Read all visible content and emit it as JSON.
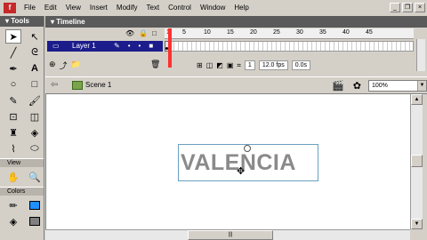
{
  "menubar": {
    "items": [
      "File",
      "Edit",
      "View",
      "Insert",
      "Modify",
      "Text",
      "Control",
      "Window",
      "Help"
    ]
  },
  "tools_panel": {
    "title": "Tools",
    "view_label": "View",
    "colors_label": "Colors",
    "fill_color": "#1e90ff"
  },
  "timeline": {
    "title": "Timeline",
    "ruler_numbers": [
      "1",
      "5",
      "10",
      "15",
      "20",
      "25",
      "30",
      "35",
      "40",
      "45"
    ],
    "layer_name": "Layer 1",
    "current_frame": "1",
    "fps": "12.0 fps",
    "elapsed": "0.0s"
  },
  "editbar": {
    "scene": "Scene 1",
    "zoom": "100%"
  },
  "stage": {
    "text": "VALENCIA"
  }
}
